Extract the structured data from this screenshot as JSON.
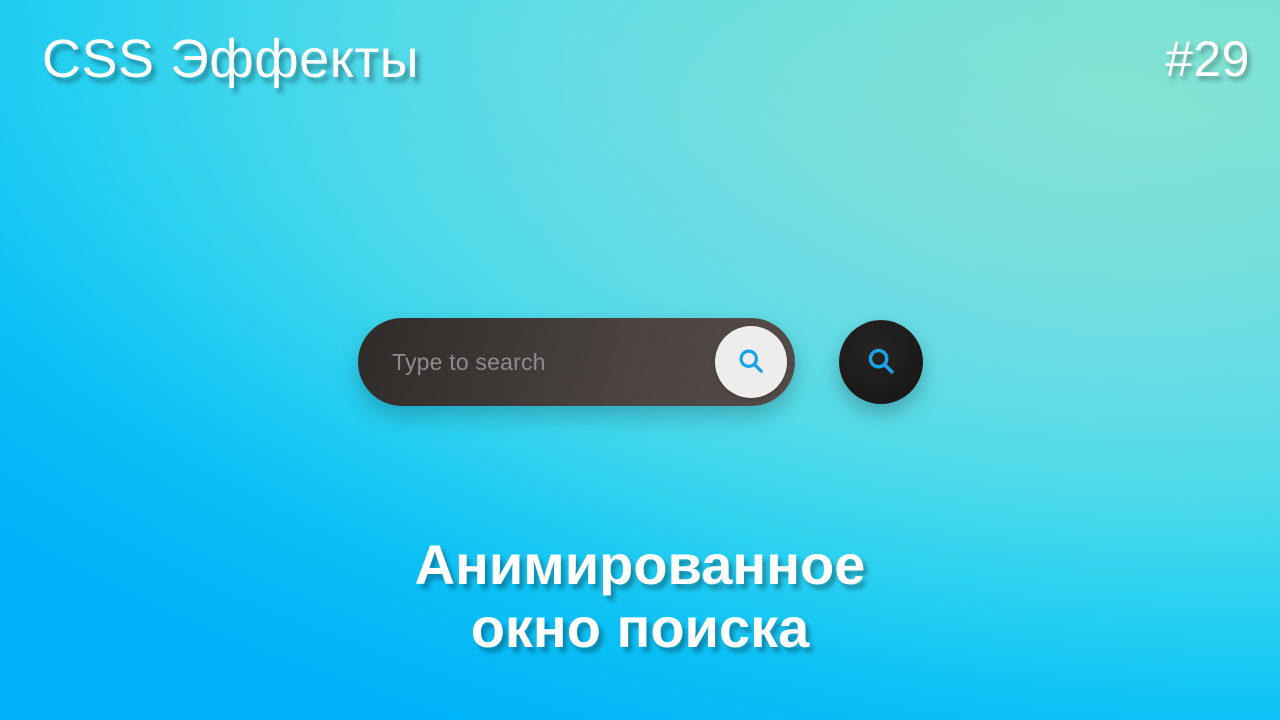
{
  "background": {
    "top_left_color": "#1ad5e8",
    "top_right_color": "#eef3bc",
    "bottom_left_color": "#00b4f8",
    "bottom_right_color": "#7fe3de"
  },
  "header": {
    "title": "CSS Эффекты",
    "episode": "#29"
  },
  "search": {
    "placeholder": "Type to search",
    "value": "",
    "submit_icon": "search-icon",
    "toggle_icon": "search-icon",
    "icon_color": "#14a5e8",
    "bar_color": "#463f3c",
    "submit_button_color": "#ededed",
    "toggle_button_color": "#1e1c1b",
    "placeholder_color": "#8e8c8a"
  },
  "caption": {
    "line1": "Анимированное",
    "line2": "окно поиска"
  }
}
